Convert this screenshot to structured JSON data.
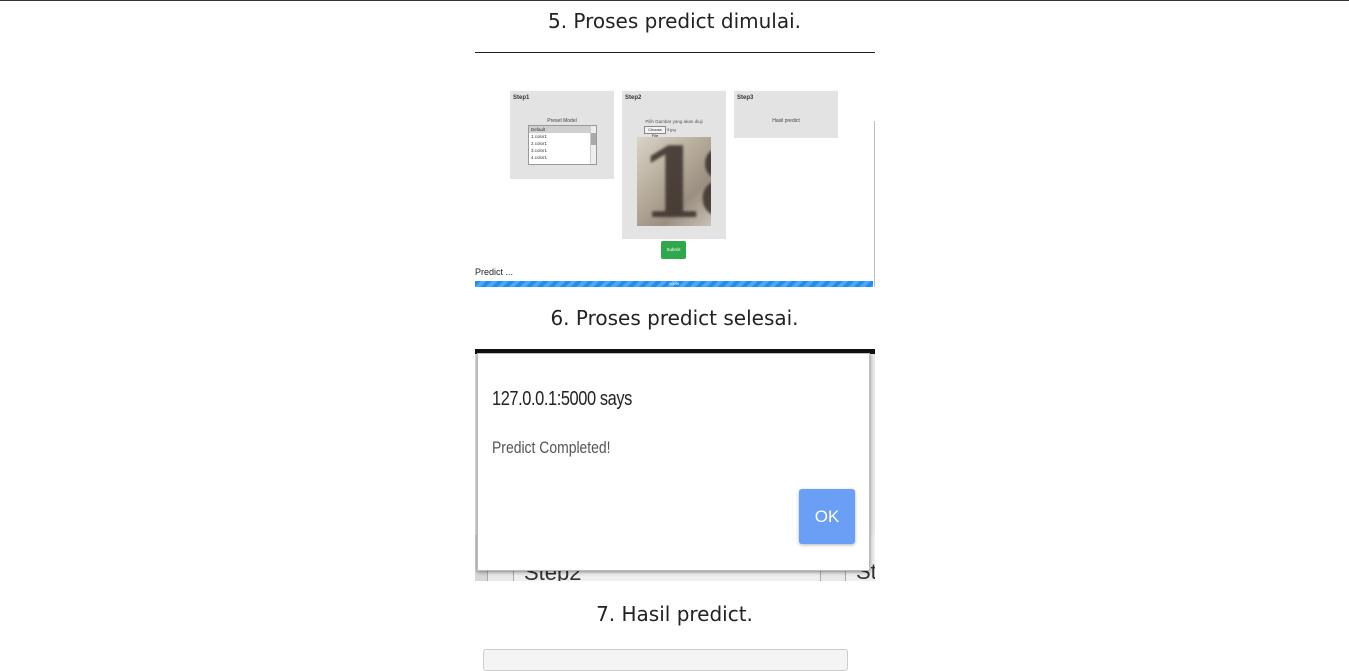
{
  "captions": {
    "step5": "5. Proses predict dimulai.",
    "step6": "6. Proses predict selesai.",
    "step7": "7. Hasil predict."
  },
  "shot1": {
    "step1_title": "Step1",
    "step1_label": "Preset Model",
    "models": [
      "Default",
      "1.color1",
      "2.color1",
      "3.color1",
      "4.color1"
    ],
    "selected_model": "Default",
    "step2_title": "Step2",
    "step2_label": "Pilih Gambar yang akan diuji",
    "file_button": "Choose File",
    "file_name": "9.jpg",
    "preview_digit": "18",
    "step3_title": "Step3",
    "step3_label": "Hasil predict",
    "submit_label": "Submit",
    "predict_status": "Predict ...",
    "progress_text": "100%",
    "progress_value": 1.0,
    "accent_color": "#1f8ef0",
    "submit_color": "#2ea84a"
  },
  "shot2": {
    "dialog_origin": "127.0.0.1:5000 says",
    "dialog_message": "Predict Completed!",
    "ok_label": "OK",
    "bg_step_left": "Step2",
    "bg_step_right": "Ste",
    "ok_color": "#6b9ef5"
  }
}
